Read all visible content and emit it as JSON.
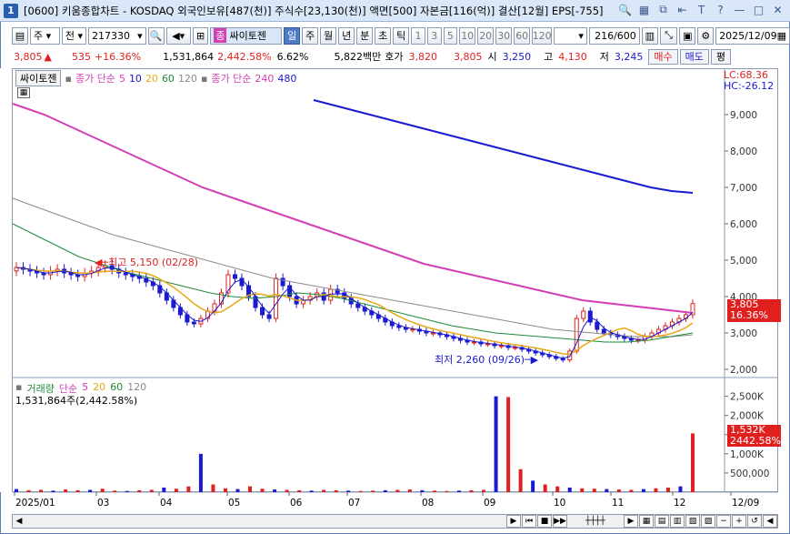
{
  "window": {
    "number": "1",
    "title": "[0600] 키움종합차트 - KOSDAQ 외국인보유[487(천)] 주식수[23,130(천)] 액면[500] 자본금[116(억)] 결산[12월] EPS[-755]",
    "icons": [
      "search-icon",
      "grid-icon",
      "restore-icon",
      "pin-icon",
      "font-icon",
      "help-icon",
      "minimize-icon",
      "maximize-icon",
      "close-icon"
    ],
    "icon_glyphs": [
      "🔍",
      "▦",
      "⧉",
      "⇤",
      "T",
      "?",
      "—",
      "□",
      "✕"
    ]
  },
  "toolbar": {
    "period_type": "주",
    "market": "전",
    "code": "217330",
    "name_badge": "종",
    "stock_name": "싸이토젠",
    "period_buttons": [
      "일",
      "주",
      "월",
      "년",
      "분",
      "초",
      "틱"
    ],
    "active_period": "일",
    "interval_buttons": [
      "1",
      "3",
      "5",
      "10",
      "20",
      "30",
      "60",
      "120"
    ],
    "count": "216/600",
    "date": "2025/12/09"
  },
  "quote": {
    "price": "3,805",
    "arrow": "▲",
    "change": "535",
    "change_pct": "+16.36%",
    "volume": "1,531,864",
    "volume_pct": "2,442.58%",
    "turnover": "6.62%",
    "amount": "5,822백만",
    "hoga_label": "호가",
    "bid": "3,820",
    "ask": "3,805",
    "open_label": "시",
    "open": "3,250",
    "high_label": "고",
    "high": "4,130",
    "low_label": "저",
    "low": "3,245",
    "buy_button": "매수",
    "sell_button": "매도",
    "eval_button": "평"
  },
  "price_legend": {
    "name": "싸이토젠",
    "ma_label": "종가 단순",
    "ma_values": [
      "5",
      "10",
      "20",
      "60",
      "120"
    ],
    "ma_long_label": "종가 단순",
    "ma_long_values": [
      "240",
      "480"
    ],
    "lc": "LC:68.36",
    "hc": "HC:-26.12"
  },
  "volume_legend": {
    "label": "거래량",
    "ma_label": "단순",
    "ma_values": [
      "5",
      "20",
      "60",
      "120"
    ],
    "volume_text": "1,531,864주(2,442.58%)"
  },
  "price_axis": [
    "9,000",
    "8,000",
    "7,000",
    "6,000",
    "5,000",
    "4,000",
    "3,000",
    "2,000"
  ],
  "volume_axis": [
    "2,500K",
    "2,000K",
    "1,500K",
    "1,000K",
    "500,000"
  ],
  "price_box": {
    "price": "3,805",
    "pct": "16.36%"
  },
  "volume_box": {
    "volume": "1,532K",
    "pct": "2442.58%"
  },
  "date_axis": [
    "2025/01",
    "03",
    "04",
    "05",
    "06",
    "07",
    "08",
    "09",
    "10",
    "11",
    "12",
    "12/09"
  ],
  "annotations": {
    "high": "최고 5,150 (02/28)",
    "low": "최저 2,260 (09/26)"
  },
  "colors": {
    "up": "#e0201f",
    "down": "#1a1ad0",
    "ma5": "#d33fb5",
    "ma10": "#1a1ad0",
    "ma20": "#e6a817",
    "ma60": "#1e8a3a",
    "ma120": "#8a8a8a",
    "ma240": "#d33fb5",
    "ma480": "#1a1ad0"
  },
  "chart_data": {
    "type": "candlestick",
    "y_range": [
      1800,
      9800
    ],
    "candles_close": [
      4800,
      4750,
      4700,
      4650,
      4600,
      4700,
      4750,
      4650,
      4600,
      4550,
      4650,
      4700,
      4800,
      4850,
      4750,
      4650,
      4600,
      4550,
      4500,
      4400,
      4300,
      4100,
      3900,
      3700,
      3500,
      3300,
      3250,
      3400,
      3600,
      3800,
      4100,
      4600,
      4500,
      4300,
      4000,
      3700,
      3500,
      3400,
      4500,
      4300,
      4000,
      3800,
      3900,
      4000,
      4100,
      3900,
      4200,
      4100,
      3950,
      3800,
      3700,
      3600,
      3500,
      3400,
      3300,
      3200,
      3150,
      3100,
      3100,
      3050,
      3000,
      3000,
      2950,
      2900,
      2850,
      2800,
      2750,
      2750,
      2700,
      2700,
      2650,
      2650,
      2600,
      2600,
      2550,
      2500,
      2450,
      2400,
      2350,
      2300,
      2260,
      2500,
      3400,
      3600,
      3300,
      3100,
      3000,
      2950,
      2900,
      2850,
      2800,
      2800,
      2900,
      3000,
      3100,
      3200,
      3300,
      3400,
      3500,
      3805
    ],
    "ma240": [
      9300,
      9150,
      9000,
      8800,
      8600,
      8400,
      8200,
      8000,
      7800,
      7600,
      7400,
      7200,
      7000,
      6850,
      6700,
      6550,
      6400,
      6250,
      6100,
      5950,
      5800,
      5650,
      5500,
      5350,
      5200,
      5050,
      4900,
      4800,
      4700,
      4600,
      4500,
      4400,
      4300,
      4200,
      4100,
      4000,
      3900,
      3850,
      3800,
      3750,
      3700,
      3650,
      3600,
      3550
    ],
    "ma480": [
      9400,
      9250,
      9100,
      8950,
      8800,
      8650,
      8500,
      8350,
      8200,
      8050,
      7900,
      7750,
      7600,
      7450,
      7300,
      7150,
      7000,
      6900,
      6850
    ],
    "ma120": [
      6700,
      6500,
      6300,
      6100,
      5900,
      5700,
      5550,
      5400,
      5250,
      5100,
      4950,
      4800,
      4650,
      4500,
      4400,
      4300,
      4200,
      4100,
      4000,
      3900,
      3800,
      3700,
      3600,
      3500,
      3400,
      3300,
      3200,
      3100,
      3050,
      3000,
      2950,
      2900,
      2900,
      2900,
      2950
    ],
    "ma60": [
      6000,
      5700,
      5400,
      5100,
      4900,
      4700,
      4550,
      4400,
      4250,
      4100,
      4000,
      3950,
      4000,
      4100,
      4050,
      3950,
      3800,
      3650,
      3500,
      3350,
      3200,
      3100,
      3000,
      2950,
      2900,
      2850,
      2800,
      2750,
      2750,
      2800,
      2900,
      3000
    ],
    "volume_k": [
      80,
      50,
      60,
      40,
      70,
      50,
      60,
      90,
      40,
      30,
      50,
      60,
      120,
      90,
      150,
      1000,
      200,
      100,
      80,
      150,
      90,
      70,
      60,
      50,
      40,
      60,
      50,
      40,
      30,
      40,
      50,
      60,
      70,
      50,
      40,
      30,
      40,
      50,
      60,
      2500,
      2480,
      600,
      300,
      200,
      150,
      120,
      100,
      90,
      80,
      70,
      60,
      80,
      100,
      120,
      150,
      1532
    ],
    "high_label": "최고 5,150 (02/28)",
    "low_label": "최저 2,260 (09/26)"
  }
}
